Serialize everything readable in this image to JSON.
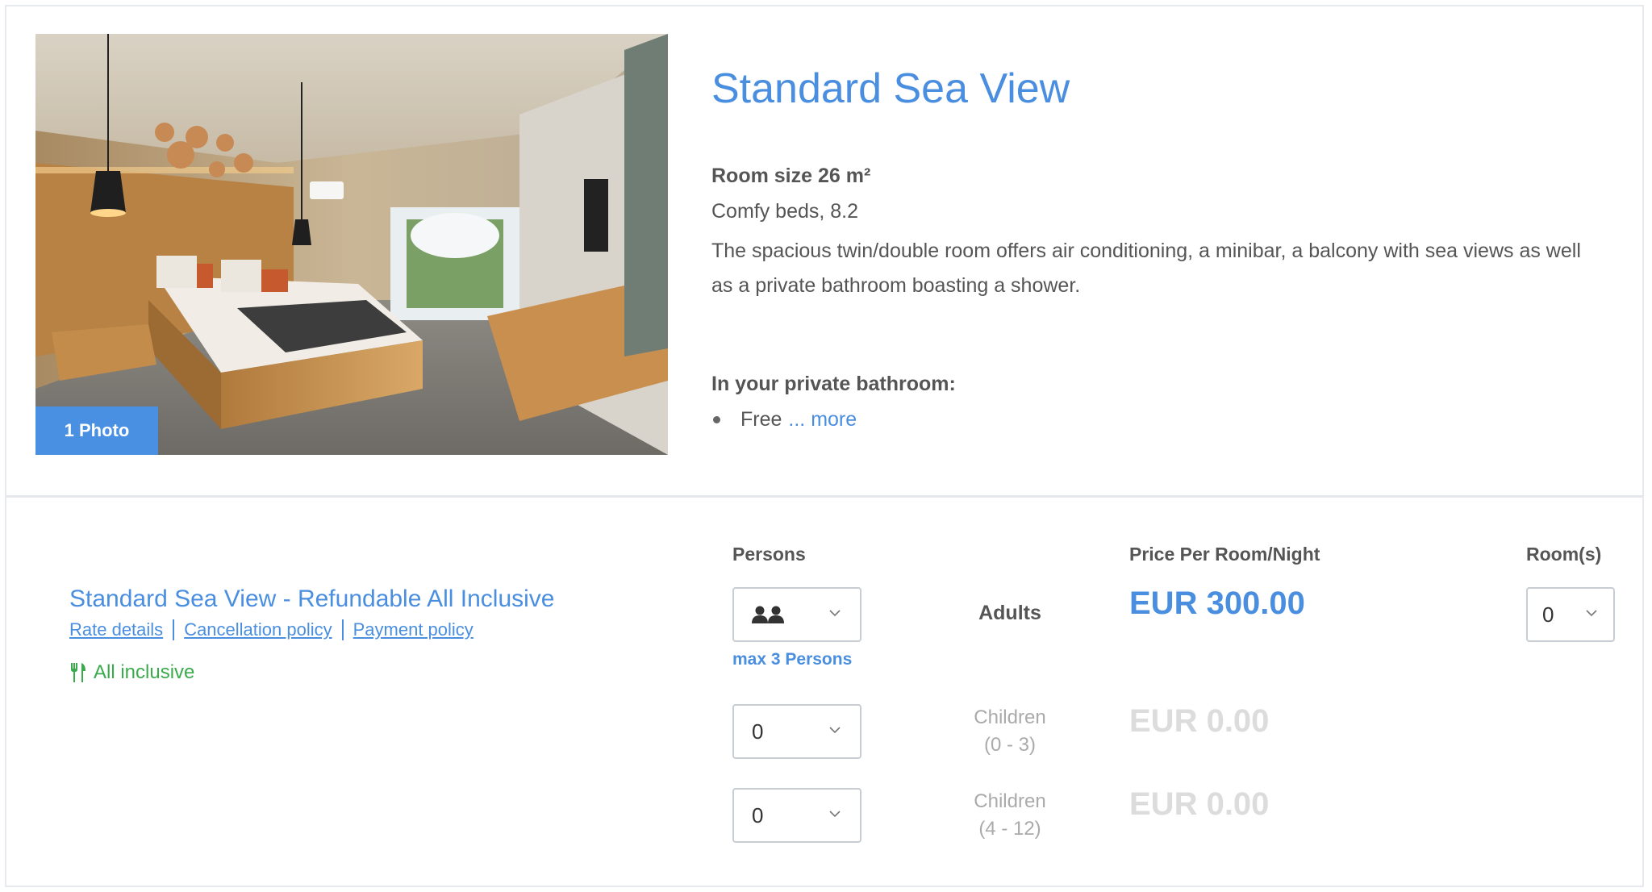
{
  "room": {
    "photo_button": "1 Photo",
    "title": "Standard Sea View",
    "size": "Room size 26 m²",
    "beds": "Comfy beds, 8.2",
    "description": "The spacious twin/double room offers air conditioning, a minibar, a balcony with sea views as well as a private bathroom boasting a shower.",
    "bathroom_title": "In your private bathroom:",
    "bathroom_items": [
      "Free"
    ],
    "more_link": "... more"
  },
  "rate": {
    "name": "Standard Sea View - Refundable All Inclusive",
    "links": [
      "Rate details",
      "Cancellation policy",
      "Payment policy"
    ],
    "board": "All inclusive",
    "board_icon": "fork-knife-icon"
  },
  "table": {
    "persons_header": "Persons",
    "price_header": "Price Per Room/Night",
    "rooms_header": "Room(s)",
    "max_persons": "max 3 Persons",
    "rows": [
      {
        "selector_icon": "two-persons-icon",
        "label": "Adults",
        "price": "EUR 300.00"
      },
      {
        "selector_value": "0",
        "label_line1": "Children",
        "label_line2": "(0 - 3)",
        "price": "EUR 0.00"
      },
      {
        "selector_value": "0",
        "label_line1": "Children",
        "label_line2": "(4 - 12)",
        "price": "EUR 0.00"
      }
    ],
    "rooms_value": "0"
  },
  "colors": {
    "accent": "#4a8ee0",
    "board_green": "#3aab4c",
    "dim_price": "#dcdcdc"
  }
}
